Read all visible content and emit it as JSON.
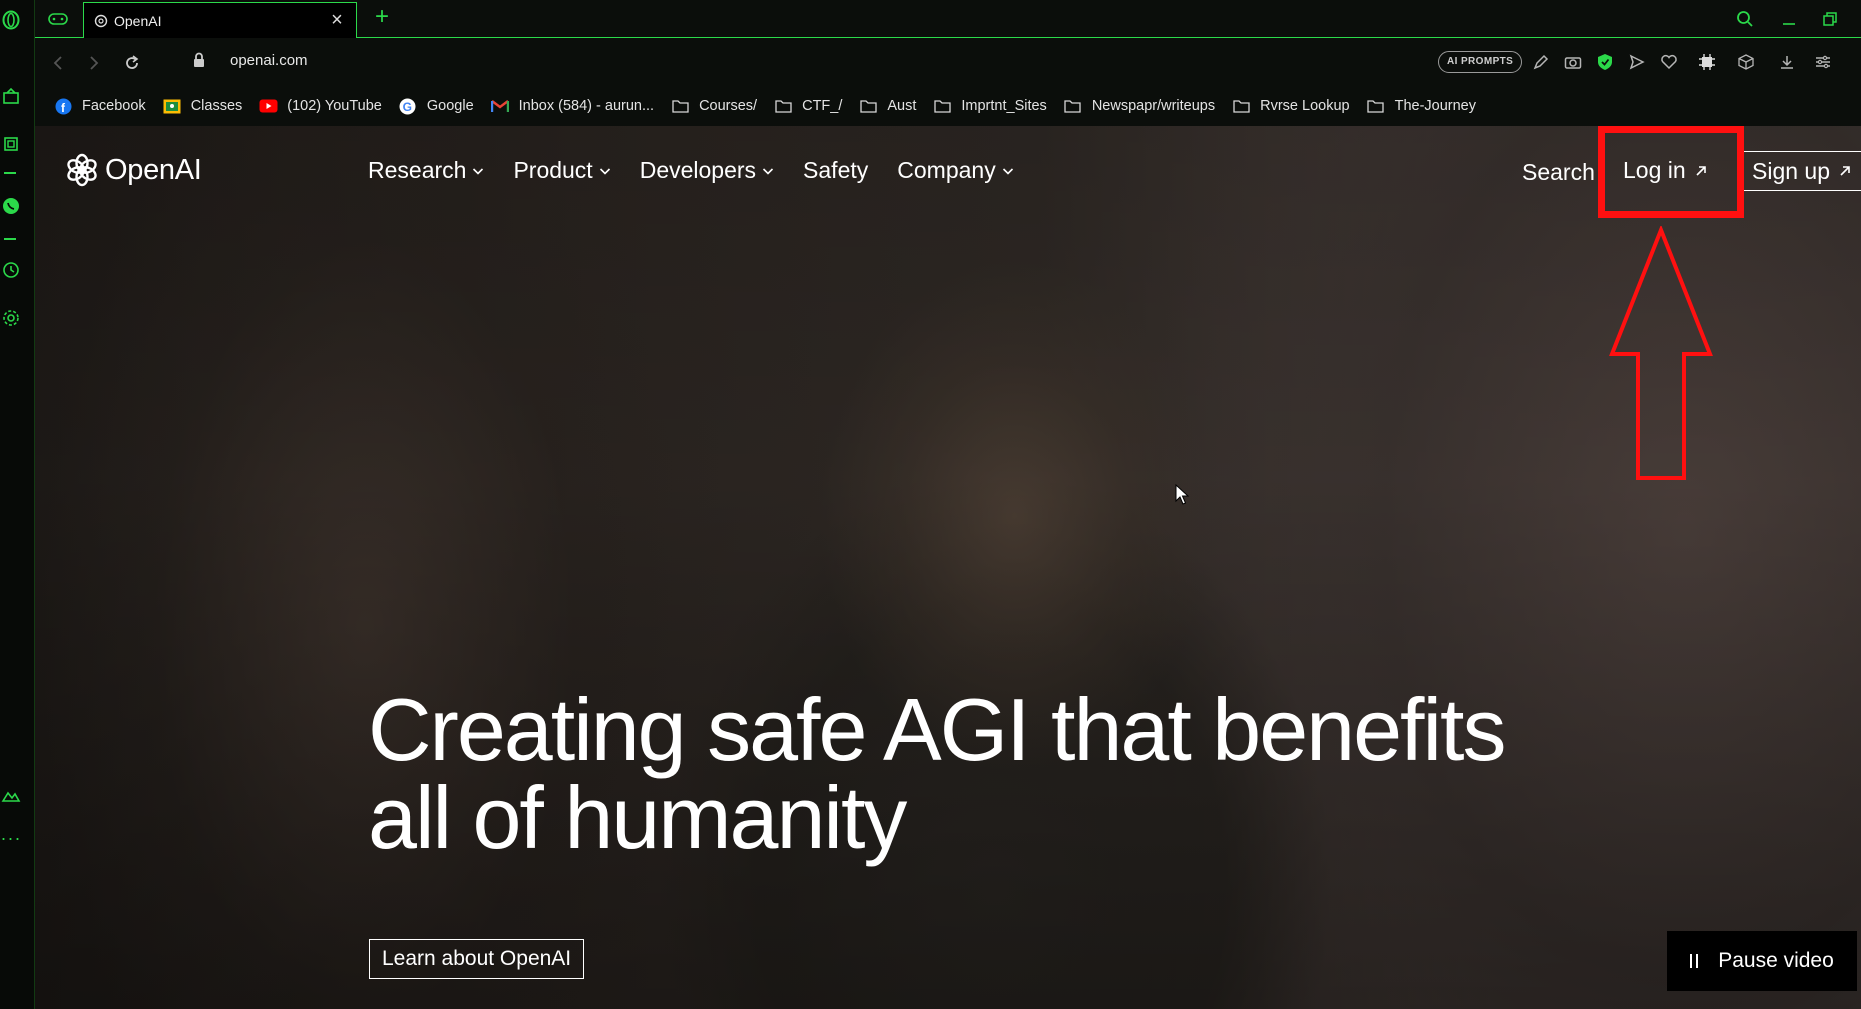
{
  "browser": {
    "tab_title": "OpenAI",
    "url": "openai.com",
    "ai_prompts_label": "AI PROMPTS",
    "accent_color": "#2bd94a"
  },
  "bookmarks": [
    {
      "label": "Facebook",
      "icon": "facebook-icon"
    },
    {
      "label": "Classes",
      "icon": "classroom-icon"
    },
    {
      "label": "(102) YouTube",
      "icon": "youtube-icon"
    },
    {
      "label": "Google",
      "icon": "google-icon"
    },
    {
      "label": "Inbox (584) - aurun...",
      "icon": "gmail-icon"
    },
    {
      "label": "Courses/",
      "icon": "folder-icon"
    },
    {
      "label": "CTF_/",
      "icon": "folder-icon"
    },
    {
      "label": "Aust",
      "icon": "folder-icon"
    },
    {
      "label": "Imprtnt_Sites",
      "icon": "folder-icon"
    },
    {
      "label": "Newspapr/writeups",
      "icon": "folder-icon"
    },
    {
      "label": "Rvrse Lookup",
      "icon": "folder-icon"
    },
    {
      "label": "The-Journey",
      "icon": "folder-icon"
    }
  ],
  "site": {
    "logo_text": "OpenAI",
    "nav": [
      {
        "label": "Research",
        "dropdown": true
      },
      {
        "label": "Product",
        "dropdown": true
      },
      {
        "label": "Developers",
        "dropdown": true
      },
      {
        "label": "Safety",
        "dropdown": false
      },
      {
        "label": "Company",
        "dropdown": true
      }
    ],
    "search_label": "Search",
    "login_label": "Log in",
    "signup_label": "Sign up",
    "hero_line1": "Creating safe AGI that benefits",
    "hero_line2": "all of humanity",
    "cta_label": "Learn about OpenAI",
    "pause_label": "Pause video"
  },
  "annotation": {
    "highlight_color": "#ff1010"
  }
}
